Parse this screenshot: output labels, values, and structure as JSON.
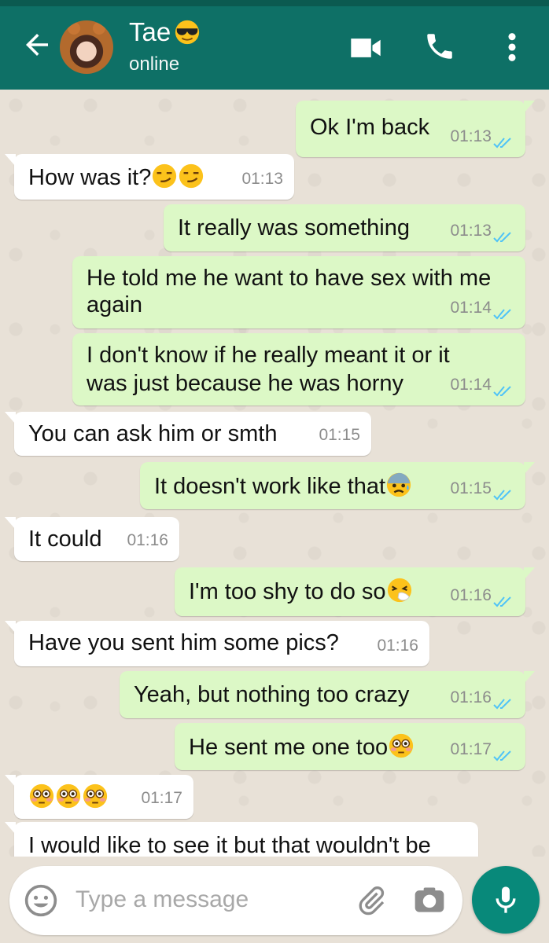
{
  "header": {
    "contact_name": "Tae",
    "status": "online",
    "icons": [
      "back-arrow-icon",
      "video-call-icon",
      "voice-call-icon",
      "more-options-icon"
    ],
    "color": "#0e7066"
  },
  "messages": [
    {
      "dir": "out",
      "text": "Ok I'm back",
      "time": "01:13"
    },
    {
      "dir": "in",
      "text": "How was it?",
      "time": "01:13",
      "emoji": [
        "smirk-emoji",
        "smirk-emoji"
      ]
    },
    {
      "dir": "out",
      "text": "It really was something",
      "time": "01:13"
    },
    {
      "dir": "out",
      "text": "He told me he want to have sex with me",
      "text2": "again",
      "time": "01:14"
    },
    {
      "dir": "out",
      "text": "I don't know if he really meant it or it",
      "text2": "was just because he was horny",
      "time": "01:14"
    },
    {
      "dir": "in",
      "text": "You can ask him or smth",
      "time": "01:15"
    },
    {
      "dir": "out",
      "text": "It doesn't work like that",
      "time": "01:15",
      "emoji": [
        "anxious-sweat-emoji"
      ]
    },
    {
      "dir": "in",
      "text": "It could",
      "time": "01:16"
    },
    {
      "dir": "out",
      "text": "I'm too shy to do so",
      "time": "01:16",
      "emoji": [
        "sneezing-emoji"
      ]
    },
    {
      "dir": "in",
      "text": "Have you sent him some pics?",
      "time": "01:16"
    },
    {
      "dir": "out",
      "text": "Yeah, but nothing too crazy",
      "time": "01:16"
    },
    {
      "dir": "out",
      "text": "He sent me one too",
      "time": "01:17",
      "emoji": [
        "flushed-emoji"
      ]
    },
    {
      "dir": "in",
      "text": "",
      "time": "01:17",
      "emoji": [
        "flushed-emoji",
        "flushed-emoji",
        "flushed-emoji"
      ]
    },
    {
      "dir": "in",
      "text": "I would like to see it but that wouldn't be",
      "time": ""
    }
  ],
  "composer": {
    "placeholder": "Type a message",
    "icons": [
      "emoji-icon",
      "attach-icon",
      "camera-icon",
      "mic-icon"
    ]
  },
  "colors": {
    "outgoing_bubble": "#dcf8c6",
    "incoming_bubble": "#ffffff",
    "read_ticks": "#4fc3f7",
    "mic_button": "#08897a"
  }
}
